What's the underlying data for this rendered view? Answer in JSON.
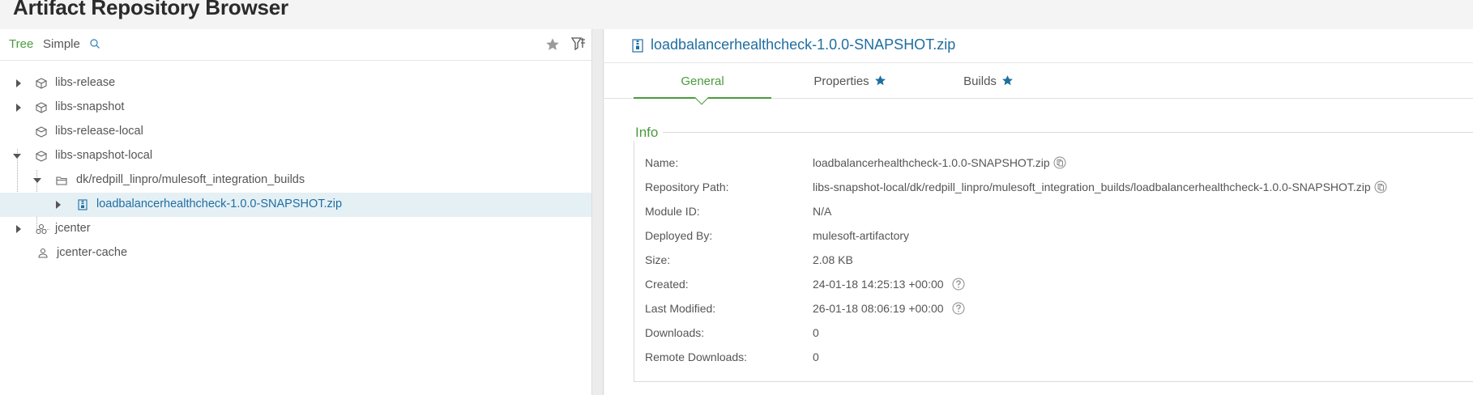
{
  "page": {
    "title": "Artifact Repository Browser"
  },
  "left": {
    "modes": {
      "tree": "Tree",
      "simple": "Simple"
    },
    "icons": {
      "search": "search-icon",
      "favorite": "star-icon",
      "filter": "filter-icon"
    }
  },
  "tree": {
    "items": [
      {
        "label": "libs-release",
        "expander": "collapsed",
        "icon": "virtual-repo-icon"
      },
      {
        "label": "libs-snapshot",
        "expander": "collapsed",
        "icon": "virtual-repo-icon"
      },
      {
        "label": "libs-release-local",
        "expander": "none",
        "icon": "local-repo-icon"
      },
      {
        "label": "libs-snapshot-local",
        "expander": "expanded",
        "icon": "local-repo-icon"
      },
      {
        "label": "dk/redpill_linpro/mulesoft_integration_builds",
        "expander": "expanded",
        "icon": "folder-icon"
      },
      {
        "label": "loadbalancerhealthcheck-1.0.0-SNAPSHOT.zip",
        "expander": "collapsed",
        "icon": "archive-icon",
        "selected": true
      },
      {
        "label": "jcenter",
        "expander": "collapsed",
        "icon": "remote-repo-icon"
      },
      {
        "label": "jcenter-cache",
        "expander": "none",
        "icon": "cache-repo-icon"
      }
    ]
  },
  "details": {
    "title": "loadbalancerhealthcheck-1.0.0-SNAPSHOT.zip",
    "tabs": {
      "general": "General",
      "properties": "Properties",
      "builds": "Builds"
    },
    "info": {
      "legend": "Info",
      "rows": [
        {
          "label": "Name:",
          "value": "loadbalancerhealthcheck-1.0.0-SNAPSHOT.zip"
        },
        {
          "label": "Repository Path:",
          "value": "libs-snapshot-local/dk/redpill_linpro/mulesoft_integration_builds/loadbalancerhealthcheck-1.0.0-SNAPSHOT.zip"
        },
        {
          "label": "Module ID:",
          "value": "N/A"
        },
        {
          "label": "Deployed By:",
          "value": "mulesoft-artifactory"
        },
        {
          "label": "Size:",
          "value": "2.08 KB"
        },
        {
          "label": "Created:",
          "value": "24-01-18 14:25:13 +00:00"
        },
        {
          "label": "Last Modified:",
          "value": "26-01-18 08:06:19 +00:00"
        },
        {
          "label": "Downloads:",
          "value": "0"
        },
        {
          "label": "Remote Downloads:",
          "value": "0"
        }
      ]
    }
  },
  "colors": {
    "accent_green": "#4a9b3c",
    "link_blue": "#1f6ea0",
    "star_blue": "#1f6ea0",
    "selected_row": "#e5f0f5"
  }
}
